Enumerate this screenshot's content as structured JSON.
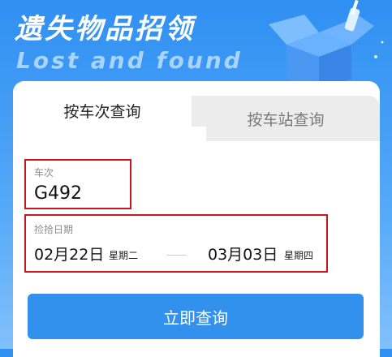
{
  "hero": {
    "title": "遗失物品招领",
    "subtitle": "Lost and found"
  },
  "tabs": [
    {
      "label": "按车次查询",
      "active": true
    },
    {
      "label": "按车站查询",
      "active": false
    }
  ],
  "form": {
    "train": {
      "label": "车次",
      "value": "G492"
    },
    "date": {
      "label": "捡拾日期",
      "start": {
        "date": "02月22日",
        "weekday": "星期二"
      },
      "end": {
        "date": "03月03日",
        "weekday": "星期四"
      }
    }
  },
  "search_button": {
    "label": "立即查询"
  },
  "colors": {
    "primary": "#3391ee",
    "header_blue": "#2f8ff2",
    "highlight_red": "#c8161d"
  }
}
